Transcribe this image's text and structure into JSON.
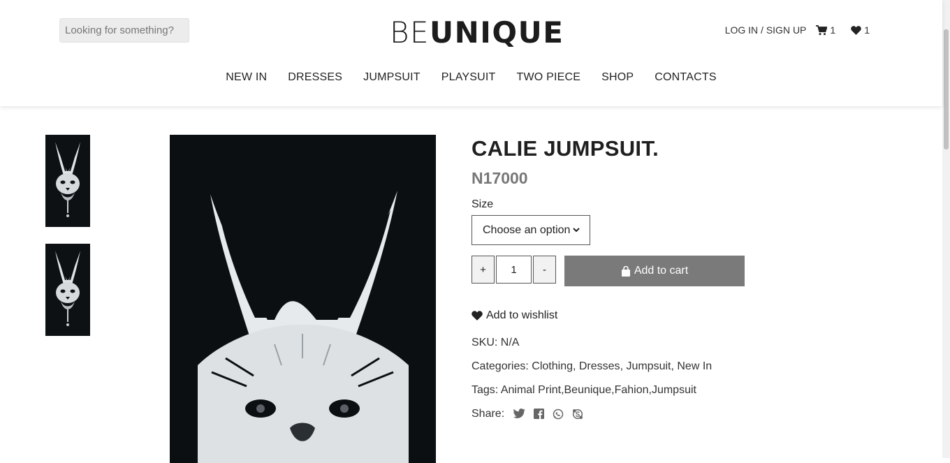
{
  "header": {
    "search_placeholder": "Looking for something?",
    "logo_light": "BE",
    "logo_bold": "UNIQUE",
    "login_label": "LOG IN / SIGN UP",
    "cart_count": "1",
    "wishlist_count": "1"
  },
  "nav": {
    "items": [
      "NEW IN",
      "DRESSES",
      "JUMPSUIT",
      "PLAYSUIT",
      "TWO PIECE",
      "SHOP",
      "CONTACTS"
    ]
  },
  "product": {
    "title": "CALIE JUMPSUIT.",
    "price": "N17000",
    "size_label": "Size",
    "size_select_value": "Choose an option",
    "qty_plus": "+",
    "qty_value": "1",
    "qty_minus": "-",
    "add_to_cart": "Add to cart",
    "add_to_wishlist": "Add to wishlist",
    "sku_label": "SKU:",
    "sku_value": "N/A",
    "categories_label": "Categories:",
    "categories": [
      "Clothing",
      "Dresses",
      "Jumpsuit",
      "New In"
    ],
    "tags_label": "Tags:",
    "tags": "Animal Print,Beunique,Fahion,Jumpsuit",
    "share_label": "Share:"
  },
  "icons": {
    "cart": "cart-icon",
    "wishlist": "heart-icon",
    "bag": "shopping-bag-icon",
    "share": [
      "twitter-icon",
      "facebook-icon",
      "whatsapp-icon",
      "skype-icon"
    ]
  },
  "colors": {
    "add_to_cart_bg": "#7a7a7a",
    "price": "#777777",
    "image_bg": "#0b0f12"
  }
}
